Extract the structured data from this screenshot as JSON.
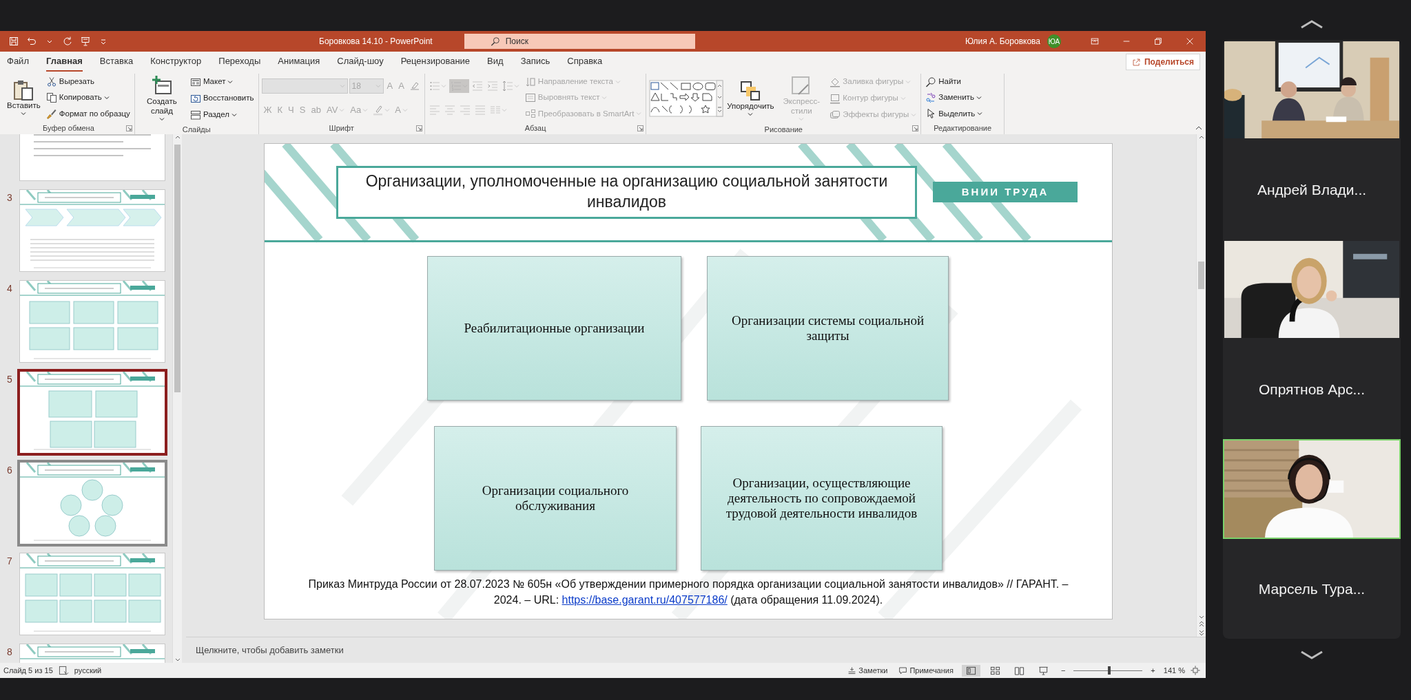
{
  "window": {
    "title": "Боровкова 14.10  -  PowerPoint",
    "search_placeholder": "Поиск",
    "user": "Юлия А. Боровкова",
    "avatar": "ЮА"
  },
  "menu_tabs": [
    {
      "label": "Файл",
      "selected": false
    },
    {
      "label": "Главная",
      "selected": true
    },
    {
      "label": "Вставка",
      "selected": false
    },
    {
      "label": "Конструктор",
      "selected": false
    },
    {
      "label": "Переходы",
      "selected": false
    },
    {
      "label": "Анимация",
      "selected": false
    },
    {
      "label": "Слайд-шоу",
      "selected": false
    },
    {
      "label": "Рецензирование",
      "selected": false
    },
    {
      "label": "Вид",
      "selected": false
    },
    {
      "label": "Запись",
      "selected": false
    },
    {
      "label": "Справка",
      "selected": false
    }
  ],
  "share_button": "Поделиться",
  "ribbon_groups": [
    {
      "label": "Буфер обмена",
      "launcher": true,
      "columns": [
        [
          [
            {
              "kind": "large",
              "label": "Вставить",
              "dropdown": true,
              "disabled": false
            }
          ]
        ],
        [
          [
            {
              "kind": "small",
              "label": "Вырезать",
              "disabled": false
            }
          ],
          [
            {
              "kind": "small",
              "label": "Копировать",
              "dropdown": true,
              "disabled": false
            }
          ],
          [
            {
              "kind": "small",
              "label": "Формат по образцу",
              "disabled": false
            }
          ]
        ]
      ]
    },
    {
      "label": "Слайды",
      "launcher": false,
      "columns": [
        [
          [
            {
              "kind": "large",
              "label": "Создать слайд",
              "dropdown": true,
              "disabled": false
            }
          ]
        ],
        [
          [
            {
              "kind": "small",
              "label": "Макет",
              "dropdown": true,
              "disabled": false
            }
          ],
          [
            {
              "kind": "small",
              "label": "Восстановить",
              "disabled": false
            }
          ],
          [
            {
              "kind": "small",
              "label": "Раздел",
              "dropdown": true,
              "disabled": false
            }
          ]
        ]
      ]
    },
    {
      "label": "Шрифт",
      "launcher": true,
      "columns": [
        [
          [
            {
              "kind": "font-combo",
              "dropdown": true,
              "disabled": true
            },
            {
              "kind": "size-combo",
              "value": "18",
              "dropdown": true,
              "disabled": true
            },
            {
              "kind": "glyph",
              "glyph": "A",
              "disabled": true
            },
            {
              "kind": "glyph",
              "glyph": "A",
              "disabled": true
            },
            {
              "kind": "icon",
              "disabled": true
            }
          ],
          [
            {
              "kind": "glyph",
              "glyph": "Ж",
              "disabled": true
            },
            {
              "kind": "glyph",
              "glyph": "К",
              "disabled": true
            },
            {
              "kind": "glyph",
              "glyph": "Ч",
              "disabled": true
            },
            {
              "kind": "glyph",
              "glyph": "S",
              "disabled": true
            },
            {
              "kind": "glyph",
              "glyph": "ab",
              "disabled": true
            },
            {
              "kind": "glyph",
              "glyph": "AV",
              "dropdown": true,
              "disabled": true
            },
            {
              "kind": "glyph",
              "glyph": "Aa",
              "dropdown": true,
              "disabled": true
            },
            {
              "kind": "icon",
              "dropdown": true,
              "disabled": true
            },
            {
              "kind": "glyph",
              "glyph": "A",
              "dropdown": true,
              "disabled": true
            }
          ]
        ]
      ]
    },
    {
      "label": "Абзац",
      "launcher": true,
      "columns": [
        [
          [
            {
              "kind": "icon",
              "dropdown": true,
              "disabled": true,
              "selected": false
            },
            {
              "kind": "icon",
              "dropdown": true,
              "disabled": true,
              "selected": true
            },
            {
              "kind": "icon",
              "disabled": true,
              "selected": false
            },
            {
              "kind": "icon",
              "disabled": true,
              "selected": false
            },
            {
              "kind": "icon",
              "dropdown": true,
              "disabled": true,
              "selected": false
            }
          ],
          [
            {
              "kind": "icon",
              "disabled": true,
              "selected": false
            },
            {
              "kind": "icon",
              "disabled": true,
              "selected": false
            },
            {
              "kind": "icon",
              "disabled": true,
              "selected": false
            },
            {
              "kind": "icon",
              "disabled": true,
              "selected": false
            },
            {
              "kind": "icon",
              "dropdown": true,
              "disabled": true,
              "selected": false
            }
          ]
        ],
        [
          [
            {
              "kind": "small",
              "label": "Направление текста",
              "dropdown": true,
              "disabled": true
            }
          ],
          [
            {
              "kind": "small",
              "label": "Выровнять текст",
              "dropdown": true,
              "disabled": true
            }
          ],
          [
            {
              "kind": "small",
              "label": "Преобразовать в SmartArt",
              "dropdown": true,
              "disabled": true
            }
          ]
        ]
      ]
    },
    {
      "label": "Рисование",
      "launcher": true,
      "columns": [
        [
          [
            {
              "kind": "gallery",
              "disabled": false
            }
          ]
        ],
        [
          [
            {
              "kind": "large",
              "label": "Упорядочить",
              "dropdown": true,
              "disabled": false
            }
          ]
        ],
        [
          [
            {
              "kind": "large",
              "label": "Экспресс-стили",
              "dropdown": true,
              "disabled": true
            }
          ]
        ],
        [
          [
            {
              "kind": "small",
              "label": "Заливка фигуры",
              "dropdown": true,
              "disabled": true
            }
          ],
          [
            {
              "kind": "small",
              "label": "Контур фигуры",
              "dropdown": true,
              "disabled": true
            }
          ],
          [
            {
              "kind": "small",
              "label": "Эффекты фигуры",
              "dropdown": true,
              "disabled": true
            }
          ]
        ]
      ]
    },
    {
      "label": "Редактирование",
      "launcher": false,
      "columns": [
        [
          [
            {
              "kind": "small",
              "label": "Найти",
              "disabled": false
            }
          ],
          [
            {
              "kind": "small",
              "label": "Заменить",
              "dropdown": true,
              "disabled": false
            }
          ],
          [
            {
              "kind": "small",
              "label": "Выделить",
              "dropdown": true,
              "disabled": false
            }
          ]
        ]
      ]
    }
  ],
  "thumbnails": [
    {
      "selected": false,
      "hovered": false
    },
    {
      "number": "3",
      "selected": false,
      "hovered": false
    },
    {
      "number": "4",
      "selected": false,
      "hovered": false
    },
    {
      "number": "5",
      "selected": true,
      "hovered": false
    },
    {
      "number": "6",
      "selected": false,
      "hovered": true
    },
    {
      "number": "7",
      "selected": false,
      "hovered": false
    },
    {
      "number": "8",
      "selected": false,
      "hovered": false
    }
  ],
  "slide": {
    "title": "Организации, уполномоченные на организацию социальной занятости инвалидов",
    "badge": "ВНИИ ТРУДА",
    "boxes": [
      "Реабилитационные организации",
      "Организации системы социальной защиты",
      "Организации социального обслуживания",
      "Организации, осуществляющие деятельность по сопровождаемой трудовой деятельности инвалидов"
    ],
    "footnote": {
      "text": "Приказ Минтруда России от 28.07.2023 № 605н «Об утверждении примерного порядка организации социальной занятости инвалидов» // ГАРАНТ. – 2024. – URL:",
      "link": "https://base.garant.ru/407577186/",
      "after": "(дата обращения 11.09.2024)."
    }
  },
  "notes_placeholder": "Щелкните, чтобы добавить заметки",
  "status_bar": {
    "slide_counter": "Слайд 5 из 15",
    "language": "русский",
    "notes_button": "Заметки",
    "comments_button": "Примечания",
    "views": [
      {
        "kind": "normal",
        "selected": true
      },
      {
        "kind": "sorter",
        "selected": false
      },
      {
        "kind": "reading",
        "selected": false
      },
      {
        "kind": "slideshow",
        "selected": false
      }
    ],
    "zoom_out": "−",
    "zoom_in": "+",
    "zoom": {
      "level": 0.52
    },
    "zoom_text": "141 %"
  },
  "participants": [
    {
      "kind": "picture",
      "active": false
    },
    {
      "kind": "name",
      "name": "Андрей Влади..."
    },
    {
      "kind": "picture",
      "active": false
    },
    {
      "kind": "name",
      "name": "Опрятнов Арс..."
    },
    {
      "kind": "picture",
      "active": true
    },
    {
      "kind": "name",
      "name": "Марсель Тура..."
    }
  ]
}
